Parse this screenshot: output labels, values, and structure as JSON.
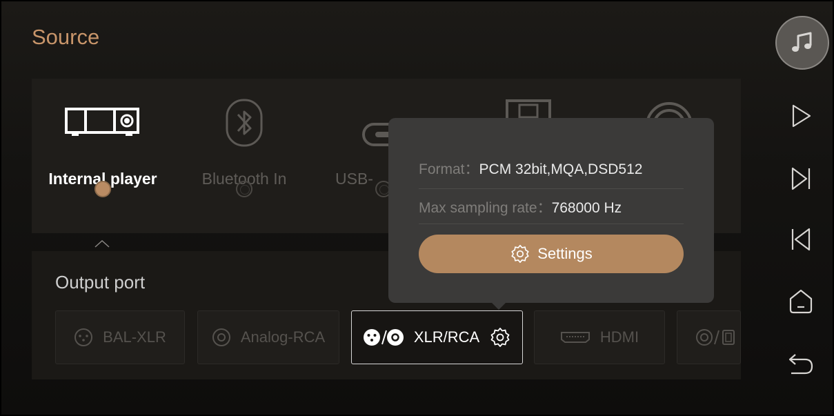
{
  "page": {
    "title": "Source"
  },
  "sources": [
    {
      "label": "Internal player",
      "icon": "player-device-icon",
      "selected": true
    },
    {
      "label": "Bluetooth In",
      "icon": "bluetooth-icon",
      "selected": false
    },
    {
      "label": "USB-",
      "icon": "usb-icon",
      "selected": false
    },
    {
      "label": "",
      "icon": "storage-icon",
      "selected": false
    },
    {
      "label": "",
      "icon": "coax-icon",
      "selected": false
    }
  ],
  "output": {
    "title": "Output port",
    "ports": [
      {
        "label": "BAL-XLR",
        "icon": "xlr-icon"
      },
      {
        "label": "Analog-RCA",
        "icon": "rca-icon"
      },
      {
        "label": "XLR/RCA",
        "icon": "xlr-rca-icon",
        "active": true
      },
      {
        "label": "HDMI",
        "icon": "hdmi-icon"
      },
      {
        "label": "",
        "icon": "rca-device-icon"
      }
    ]
  },
  "popup": {
    "format_key": "Format：",
    "format_value": "PCM 32bit,MQA,DSD512",
    "rate_key": "Max sampling rate：",
    "rate_value": "768000 Hz",
    "settings_label": "Settings"
  },
  "rail": [
    "music-note-icon",
    "play-icon",
    "next-icon",
    "previous-icon",
    "home-icon",
    "back-icon"
  ],
  "colors": {
    "accent": "#b4885f",
    "title": "#c8956a",
    "popup_bg": "#3b3a39"
  }
}
